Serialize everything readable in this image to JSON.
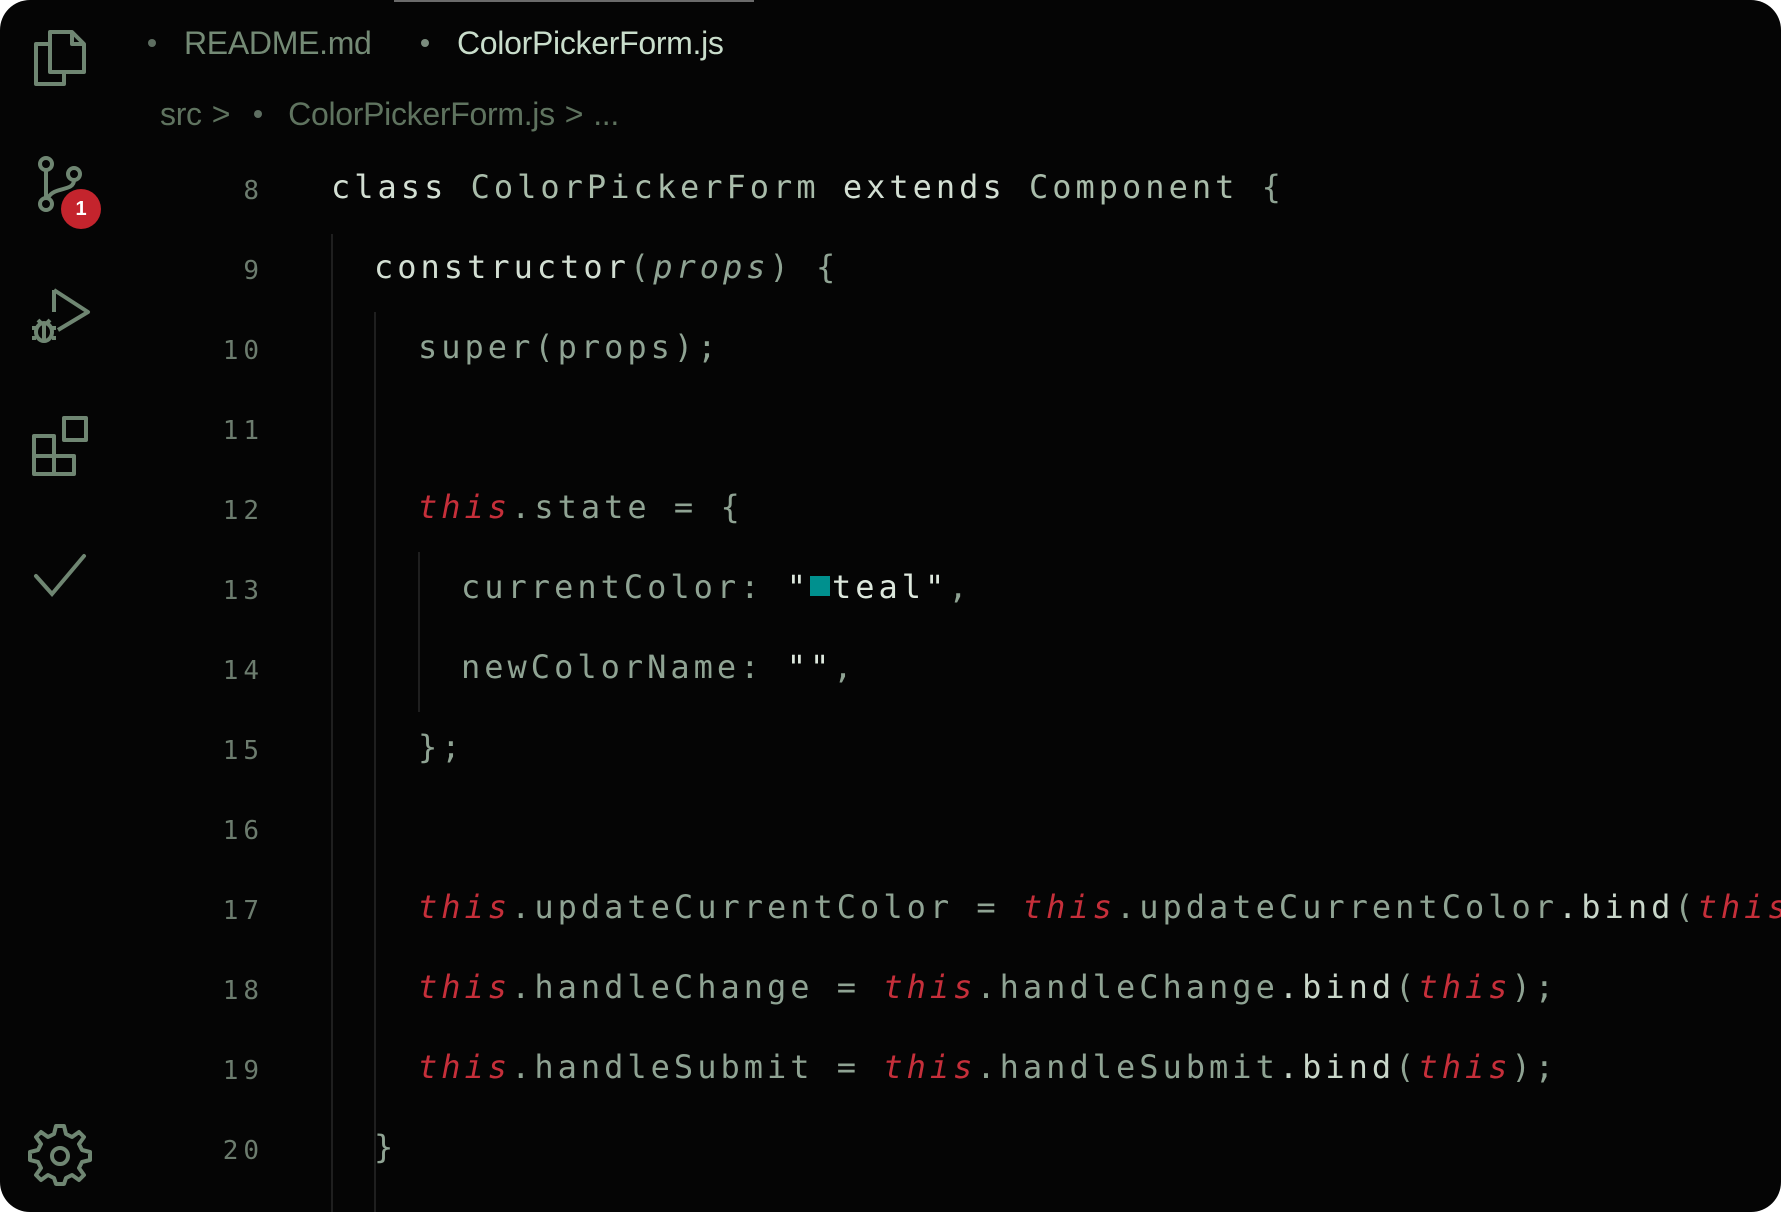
{
  "tabs": [
    {
      "label": "README.md",
      "active": false
    },
    {
      "label": "ColorPickerForm.js",
      "active": true
    }
  ],
  "breadcrumb": {
    "folder": "src",
    "separator": ">",
    "file": "ColorPickerForm.js",
    "ellipsis": "..."
  },
  "activity_bar": {
    "icons": [
      "files-icon",
      "source-control-icon",
      "run-debug-icon",
      "extensions-icon",
      "check-icon",
      "gear-icon"
    ],
    "source_control_badge": "1"
  },
  "colors": {
    "background": "#050505",
    "this_keyword": "#c62f3a",
    "teal_swatch": "#00908e",
    "badge": "#c4242d"
  },
  "code": {
    "lines": [
      {
        "n": "8"
      },
      {
        "n": "9"
      },
      {
        "n": "10"
      },
      {
        "n": "11"
      },
      {
        "n": "12"
      },
      {
        "n": "13"
      },
      {
        "n": "14"
      },
      {
        "n": "15"
      },
      {
        "n": "16"
      },
      {
        "n": "17"
      },
      {
        "n": "18"
      },
      {
        "n": "19"
      },
      {
        "n": "20"
      }
    ],
    "tokens": {
      "class_kw": "class",
      "class_name": "ColorPickerForm",
      "extends_kw": "extends",
      "base_class": "Component",
      "open_brace": "{",
      "close_brace": "}",
      "constructor_kw": "constructor",
      "open_paren": "(",
      "close_paren": ")",
      "props_param": "props",
      "super_call": "super(props);",
      "this_kw": "this",
      "state_assign": ".state = ",
      "current_color_key": "currentColor: ",
      "quote": "\"",
      "teal_value": "teal",
      "comma": ",",
      "new_color_key": "newColorName: ",
      "empty_string": "\"\"",
      "state_close": "};",
      "update_lhs": ".updateCurrentColor = ",
      "update_rhs": ".updateCurrentColor",
      "change_lhs": ".handleChange = ",
      "change_rhs": ".handleChange",
      "submit_lhs": ".handleSubmit = ",
      "submit_rhs": ".handleSubmit",
      "bind_method": ".bind",
      "call_end": ");"
    }
  }
}
